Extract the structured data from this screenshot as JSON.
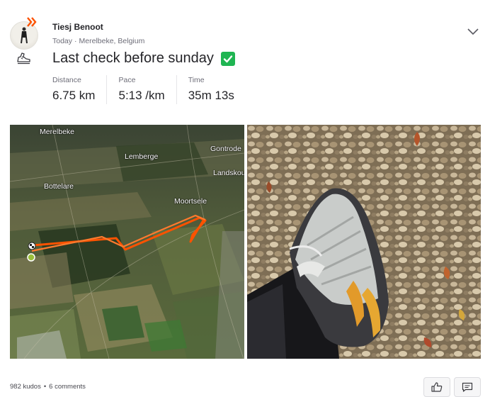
{
  "athlete": {
    "name": "Tiesj Benoot"
  },
  "activity": {
    "date": "Today",
    "separator": "·",
    "location": "Merelbeke, Belgium",
    "title": "Last check before sunday",
    "sport_icon": "run-shoe-icon",
    "title_emoji": "check-mark-button-icon"
  },
  "stats": [
    {
      "label": "Distance",
      "value": "6.75 km"
    },
    {
      "label": "Pace",
      "value": "5:13 /km"
    },
    {
      "label": "Time",
      "value": "35m 13s"
    }
  ],
  "map": {
    "places": [
      "Merelbeke",
      "Lemberge",
      "Gontrode",
      "Landskouter",
      "Bottelare",
      "Moortsele"
    ],
    "route_color": "#fc5200"
  },
  "social": {
    "kudos": "982 kudos",
    "dot": "•",
    "comments": "6 comments",
    "kudos_icon": "thumbs-up-icon",
    "comment_icon": "comment-icon"
  },
  "colors": {
    "accent": "#fc5200",
    "check": "#1fb552"
  }
}
